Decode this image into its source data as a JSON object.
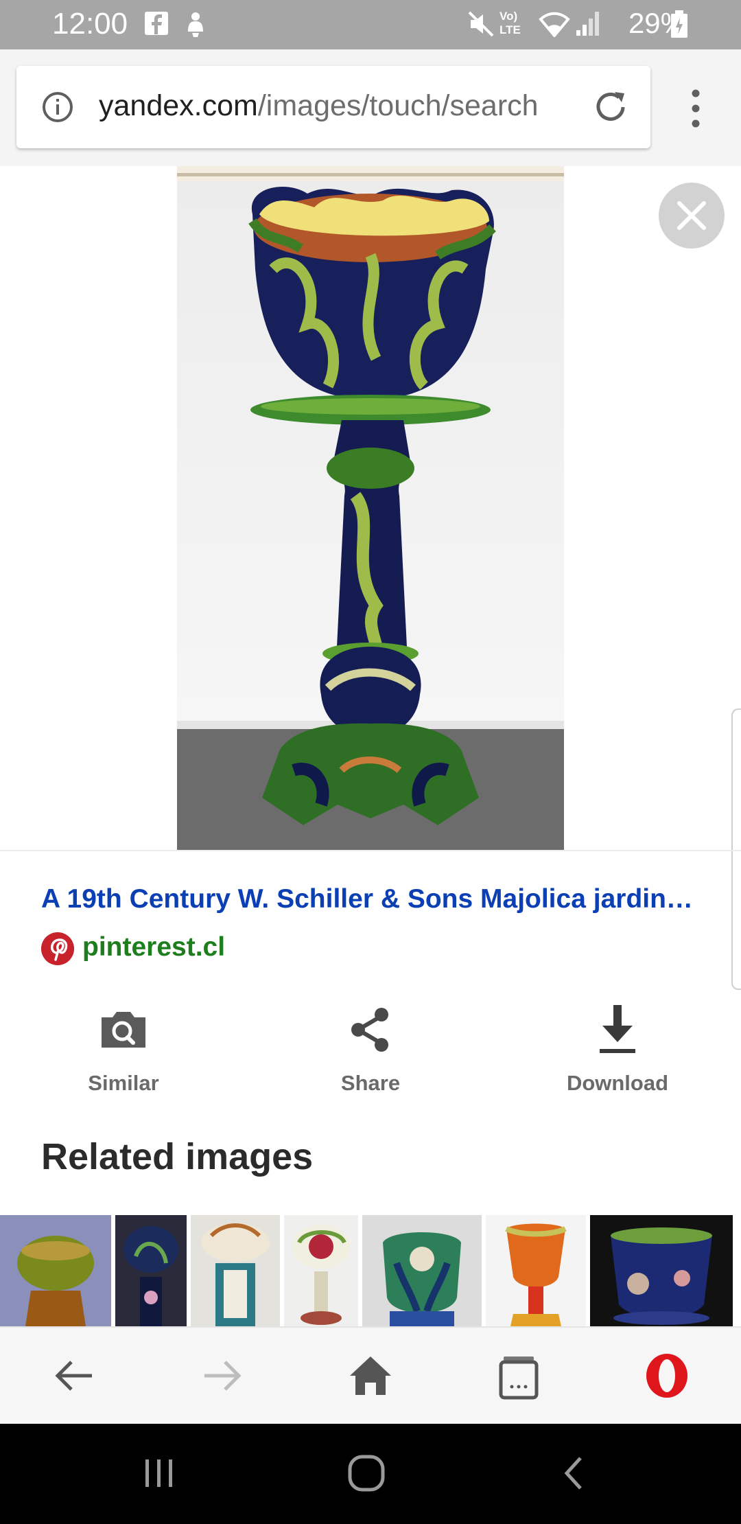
{
  "status_bar": {
    "time": "12:00",
    "network_label": "Vo) LTE",
    "battery": "29%"
  },
  "browser": {
    "url_domain": "yandex.com",
    "url_path": "/images/touch/search"
  },
  "result": {
    "title": "A 19th Century W. Schiller & Sons Majolica jardin…",
    "source": "pinterest.cl"
  },
  "actions": [
    {
      "label": "Similar",
      "icon": "camera-search-icon"
    },
    {
      "label": "Share",
      "icon": "share-icon"
    },
    {
      "label": "Download",
      "icon": "download-icon"
    }
  ],
  "related": {
    "heading": "Related images"
  },
  "colors": {
    "title_link": "#0b3fb3",
    "source_link": "#1e7e1e",
    "opera_red": "#e0161d",
    "pinterest_red": "#c8232c"
  }
}
